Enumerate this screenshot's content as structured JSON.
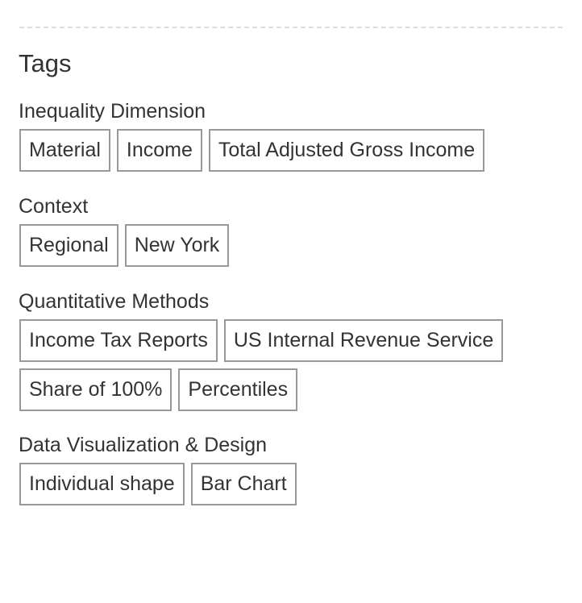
{
  "heading": "Tags",
  "sections": [
    {
      "label": "Inequality Dimension",
      "rows": [
        [
          "Material",
          "Income",
          "Total Adjusted Gross Income"
        ]
      ]
    },
    {
      "label": "Context",
      "rows": [
        [
          "Regional",
          "New York"
        ]
      ]
    },
    {
      "label": "Quantitative Methods",
      "rows": [
        [
          "Income Tax Reports",
          "US Internal Revenue Service"
        ],
        [
          "Share of 100%",
          "Percentiles"
        ]
      ]
    },
    {
      "label": "Data Visualization & Design",
      "rows": [
        [
          "Individual shape",
          "Bar Chart"
        ]
      ]
    }
  ]
}
